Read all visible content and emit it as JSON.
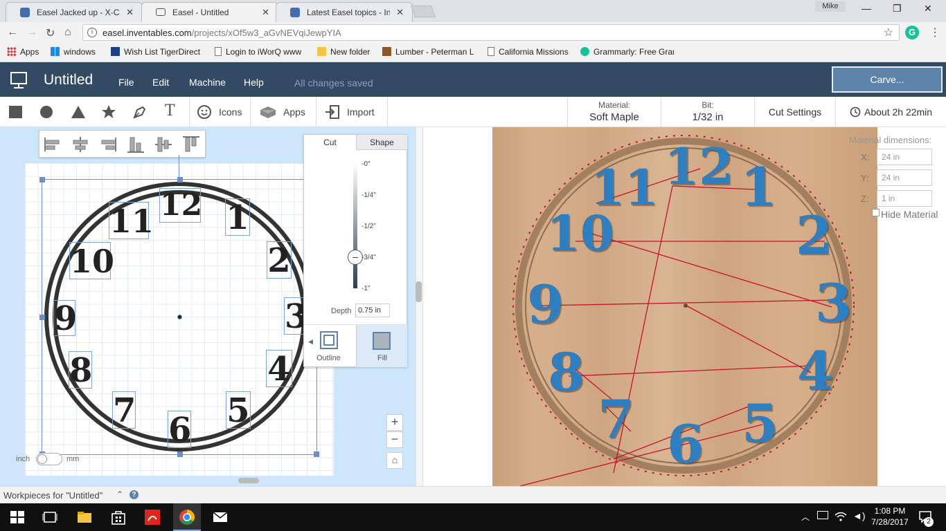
{
  "browser": {
    "tabs": [
      {
        "title": "Easel Jacked up - X-Carve"
      },
      {
        "title": "Easel - Untitled"
      },
      {
        "title": "Latest Easel topics - Inventables"
      }
    ],
    "user": "Mike",
    "url_host": "easel.inventables.com",
    "url_path": "/projects/xOf5w3_aGvNEVqiJewpYIA",
    "bookmarks": [
      "Apps",
      "windows",
      "Wish List TigerDirect",
      "Login to iWorQ www",
      "New folder",
      "Lumber - Peterman L",
      "California Missions",
      "Grammarly: Free Gran"
    ]
  },
  "app": {
    "title": "Untitled",
    "menu": [
      "File",
      "Edit",
      "Machine",
      "Help"
    ],
    "status": "All changes saved",
    "carve_label": "Carve..."
  },
  "toolbar": {
    "icons_label": "Icons",
    "apps_label": "Apps",
    "import_label": "Import",
    "material_label": "Material:",
    "material_value": "Soft Maple",
    "bit_label": "Bit:",
    "bit_value": "1/32 in",
    "cut_settings_label": "Cut Settings",
    "time_label": "About 2h 22min"
  },
  "design": {
    "numerals": [
      "12",
      "1",
      "2",
      "3",
      "4",
      "5",
      "6",
      "7",
      "8",
      "9",
      "10",
      "11"
    ],
    "unit_left": "inch",
    "unit_right": "mm",
    "zoom_in": "+",
    "zoom_out": "−"
  },
  "cut_panel": {
    "tab_cut": "Cut",
    "tab_shape": "Shape",
    "depth_marks": [
      "-0\"",
      "-1/4\"",
      "-1/2\"",
      "-3/4\"",
      "-1\""
    ],
    "depth_label": "Depth",
    "depth_value": "0.75 in",
    "depth_fraction": 0.75,
    "outline_label": "Outline",
    "fill_label": "Fill"
  },
  "material_dims": {
    "title": "Material dimensions:",
    "x_label": "X:",
    "x_value": "24 in",
    "y_label": "Y:",
    "y_value": "24 in",
    "z_label": "Z:",
    "z_value": "1 in",
    "hide_label": "Hide Material"
  },
  "footer": {
    "workpieces_label": "Workpieces for \"Untitled\""
  },
  "taskbar": {
    "time": "1:08 PM",
    "date": "7/28/2017",
    "notif_count": "2"
  },
  "colors": {
    "header_bg": "#324a62",
    "carve_button": "#5d83ab",
    "canvas_bg": "#cde6fb",
    "preview_fill": "#2e7fc1",
    "toolpath": "#c8102e"
  }
}
